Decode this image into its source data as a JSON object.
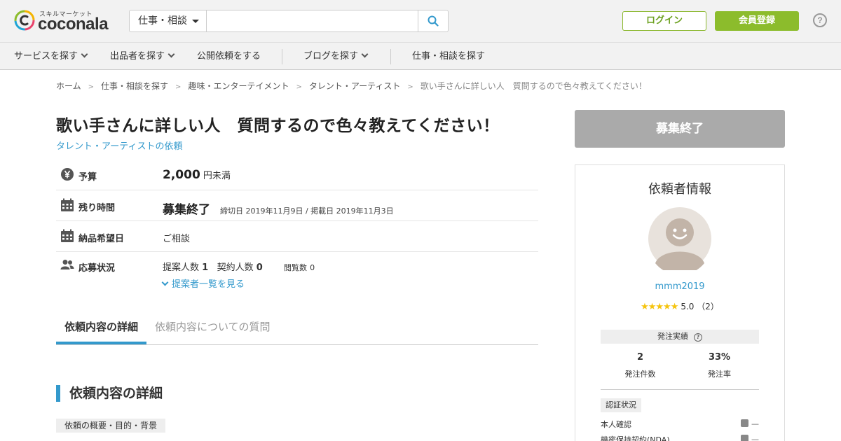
{
  "header": {
    "logo_tagline": "スキルマーケット",
    "logo_text": "coconala",
    "search_category": "仕事・相談",
    "search_placeholder": "",
    "login_label": "ログイン",
    "register_label": "会員登録",
    "help_label": "?"
  },
  "nav": {
    "items": [
      {
        "label": "サービスを探す"
      },
      {
        "label": "出品者を探す"
      },
      {
        "label": "公開依頼をする"
      },
      {
        "label": "ブログを探す"
      },
      {
        "label": "仕事・相談を探す"
      }
    ]
  },
  "breadcrumb": {
    "items": [
      "ホーム",
      "仕事・相談を探す",
      "趣味・エンターテイメント",
      "タレント・アーティスト"
    ],
    "current": "歌い手さんに詳しい人　質問するので色々教えてください！",
    "separator": ">"
  },
  "request": {
    "title": "歌い手さんに詳しい人　質問するので色々教えてください！",
    "category_link": "タレント・アーティストの依頼",
    "budget_label": "予算",
    "budget_value": "2,000",
    "budget_suffix": "円未満",
    "remaining_label": "残り時間",
    "remaining_value": "募集終了",
    "remaining_meta": "締切日 2019年11月9日 / 掲載日 2019年11月3日",
    "delivery_label": "納品希望日",
    "delivery_value": "ご相談",
    "status_label": "応募状況",
    "proposals_label": "提案人数",
    "proposals_count": "1",
    "contracts_label": "契約人数",
    "contracts_count": "0",
    "views_label": "閲覧数",
    "views_count": "0",
    "proposer_list_link": "提案者一覧を見る"
  },
  "tabs": [
    {
      "label": "依頼内容の詳細",
      "active": true
    },
    {
      "label": "依頼内容についての質問",
      "active": false
    }
  ],
  "detail": {
    "section_title": "依頼内容の詳細",
    "sub_heading": "依頼の概要・目的・背景"
  },
  "sidebar": {
    "closed_label": "募集終了",
    "client_heading": "依頼者情報",
    "username": "mmm2019",
    "stars": "★★★★★",
    "rating": "5.0",
    "rating_count": "（2）",
    "order_record_label": "発注実績",
    "orders_count": "2",
    "orders_label": "発注件数",
    "order_rate": "33%",
    "order_rate_label": "発注率",
    "cert_label": "認証状況",
    "cert_items": [
      {
        "label": "本人確認",
        "status": "—"
      },
      {
        "label": "機密保持契約(NDA)",
        "status": "—"
      }
    ]
  },
  "colors": {
    "brand_green": "#8cbc2c",
    "link_blue": "#3399cc",
    "star_yellow": "#f5c40f",
    "closed_gray": "#aaaaaa"
  }
}
